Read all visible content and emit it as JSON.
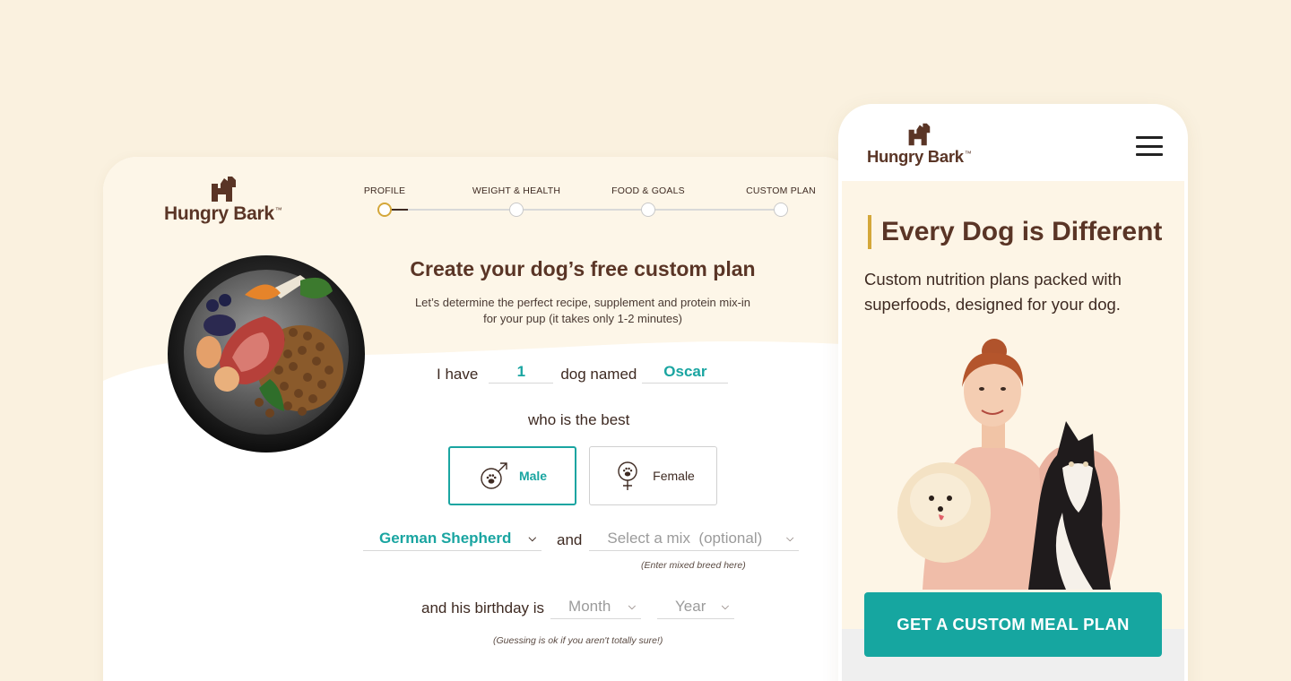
{
  "brand": {
    "name": "Hungry Bark",
    "mark": "™"
  },
  "colors": {
    "teal": "#1aa5a1",
    "brown": "#5a3526",
    "gold": "#d4a73a",
    "cream": "#faf1df"
  },
  "desktop": {
    "steps": [
      {
        "label": "PROFILE",
        "active": true
      },
      {
        "label": "WEIGHT & HEALTH",
        "active": false
      },
      {
        "label": "FOOD & GOALS",
        "active": false
      },
      {
        "label": "CUSTOM PLAN",
        "active": false
      }
    ],
    "title": "Create your dog’s free custom plan",
    "subtitle_line1": "Let’s determine the perfect recipe, supplement and protein mix-in",
    "subtitle_line2": "for your pup (it takes only 1-2 minutes)",
    "form": {
      "i_have": "I have",
      "count_value": "1",
      "dog_named": "dog named",
      "name_value": "Oscar",
      "who_is": "who is the best",
      "gender_male": "Male",
      "gender_female": "Female",
      "breed_value": "German Shepherd",
      "and": "and",
      "mix_placeholder": "Select a mix  (optional)",
      "mix_hint": "(Enter mixed breed here)",
      "birthday_label": "and his birthday is",
      "month_placeholder": "Month",
      "year_placeholder": "Year",
      "birthday_hint": "(Guessing is ok if you aren't totally sure!)"
    }
  },
  "mobile": {
    "title": "Every Dog is Different",
    "text": "Custom nutrition plans packed with superfoods, designed for your dog.",
    "cta": "GET A CUSTOM MEAL PLAN"
  }
}
